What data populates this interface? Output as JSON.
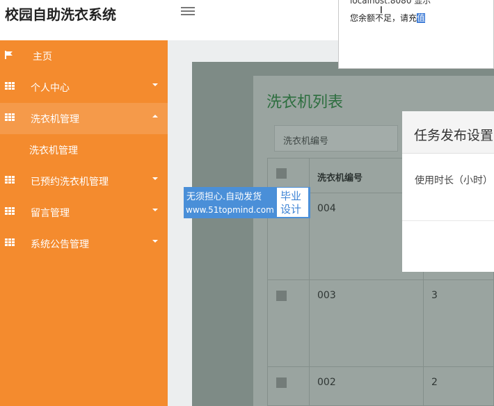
{
  "app": {
    "title": "校园自助洗衣系统"
  },
  "sidebar": {
    "items": [
      {
        "label": "主页",
        "icon": "flag-icon"
      },
      {
        "label": "个人中心",
        "icon": "grid-icon"
      },
      {
        "label": "洗衣机管理",
        "icon": "grid-icon",
        "expanded": true
      },
      {
        "label": "已预约洗衣机管理",
        "icon": "grid-icon"
      },
      {
        "label": "留言管理",
        "icon": "grid-icon"
      },
      {
        "label": "系统公告管理",
        "icon": "grid-icon"
      }
    ],
    "subitems": [
      {
        "label": "洗衣机管理"
      }
    ]
  },
  "main": {
    "title": "洗衣机列表",
    "search": {
      "placeholder": "洗衣机编号"
    },
    "table": {
      "columns": [
        "洗衣机编号"
      ],
      "rows": [
        {
          "id": "004",
          "value": ""
        },
        {
          "id": "003",
          "value": "3"
        },
        {
          "id": "002",
          "value": "2"
        }
      ]
    }
  },
  "dialog": {
    "title": "任务发布设置",
    "field_label": "使用时长（小时）"
  },
  "alert": {
    "source": "localhost:8080 显示",
    "message_main": "您余额不足，请充",
    "message_selected": "值"
  },
  "ad": {
    "slogan": "无须担心.自动发货",
    "url": "www.51topmind.com",
    "badge_line1": "毕业",
    "badge_line2": "设计"
  },
  "colors": {
    "sidebar": "#f48b2e",
    "sidebar_active": "#f59a4a",
    "title_green": "#2d6e3f",
    "ad_blue": "#4a8fd8"
  }
}
